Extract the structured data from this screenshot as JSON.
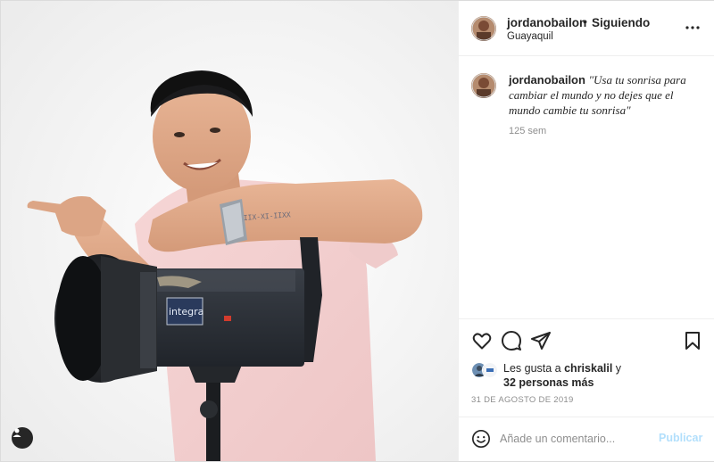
{
  "post": {
    "username": "jordanobailon",
    "separator": "•",
    "follow_status": "Siguiendo",
    "location": "Guayaquil",
    "more_icon": "more-horizontal-icon",
    "caption": {
      "username": "jordanobailon",
      "text": "\"Usa tu sonrisa para cambiar el mundo y no dejes que el mundo cambie tu sonrisa\""
    },
    "time_ago": "125 sem",
    "image_text": {
      "tattoo": "IIX-XI-IIXX",
      "brand": "integra"
    },
    "actions": {
      "like_icon": "heart-icon",
      "comment_icon": "comment-icon",
      "share_icon": "send-icon",
      "save_icon": "bookmark-icon"
    },
    "likes": {
      "prefix": "Les gusta a ",
      "user": "chriskalil",
      "joiner": " y ",
      "others": "32 personas más"
    },
    "date": "31 DE AGOSTO DE 2019",
    "comment": {
      "placeholder": "Añade un comentario...",
      "publish_label": "Publicar",
      "emoji_icon": "emoji-icon"
    }
  },
  "colors": {
    "text": "#262626",
    "muted": "#8e8e8e",
    "publish_disabled": "#b2dffc",
    "border": "#dbdbdb"
  }
}
